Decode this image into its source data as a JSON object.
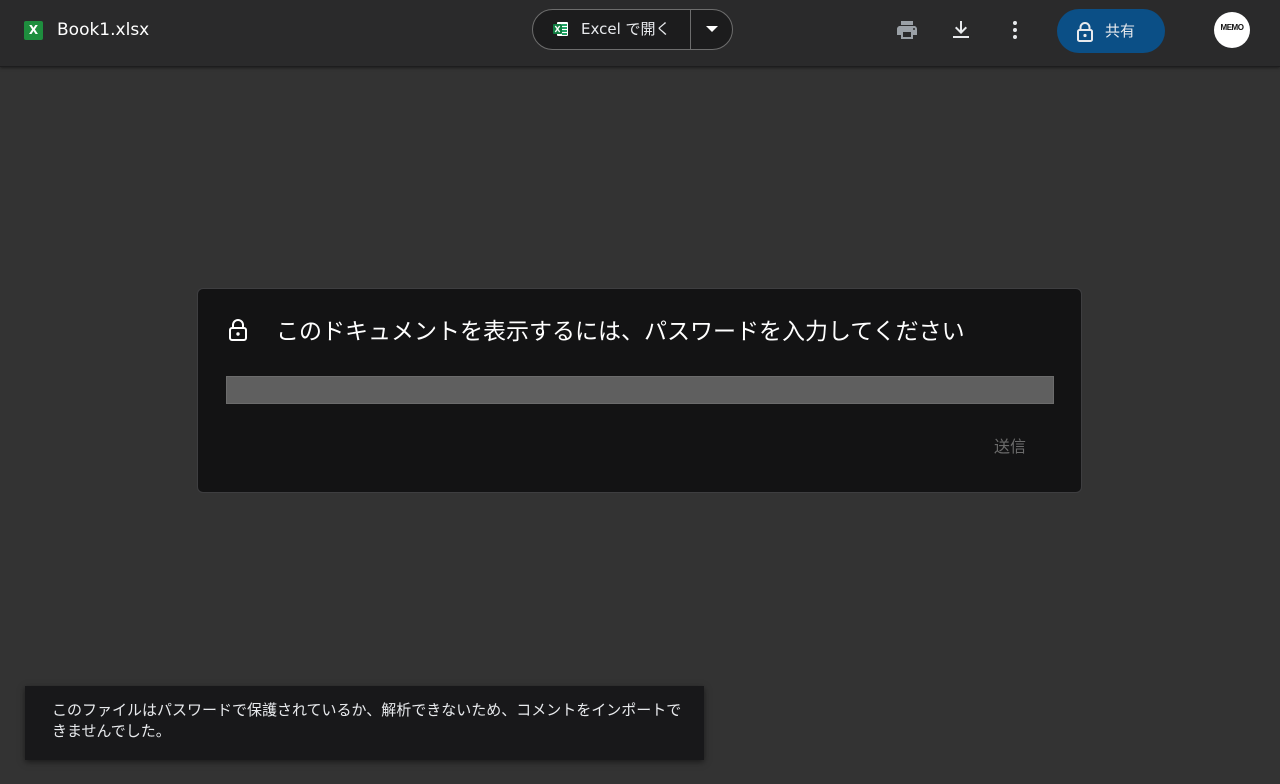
{
  "topbar": {
    "file_icon_letter": "X",
    "file_name": "Book1.xlsx",
    "open_with_label": "Excel で開く",
    "icons": [
      "excel-icon",
      "chevron-down-icon",
      "print-icon",
      "download-icon",
      "more-vert-icon",
      "lock-icon"
    ],
    "share_label": "共有",
    "avatar_text": "MEMO"
  },
  "dialog": {
    "title": "このドキュメントを表示するには、パスワードを入力してください",
    "password_value": "",
    "submit_label": "送信"
  },
  "toast": {
    "message": "このファイルはパスワードで保護されているか、解析できないため、コメントをインポートできませんでした。"
  },
  "colors": {
    "background": "#333333",
    "topbar": "#2a2a2b",
    "dialog": "#131314",
    "share_button": "#0b4f86",
    "excel_green": "#1e8e3e"
  }
}
